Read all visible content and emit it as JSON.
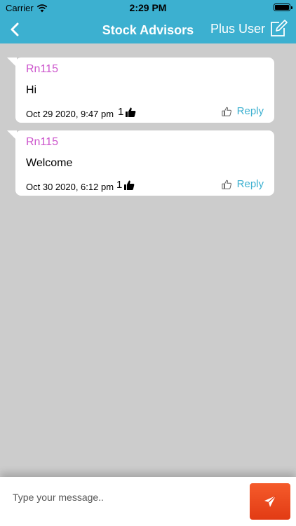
{
  "status_bar": {
    "carrier": "Carrier",
    "time": "2:29 PM"
  },
  "nav": {
    "title": "Stock Advisors",
    "plus_user_label": "Plus User"
  },
  "messages": [
    {
      "author": "Rn115",
      "text": "Hi",
      "date": "Oct 29 2020, 9:47 pm",
      "likes": "1",
      "reply_label": "Reply"
    },
    {
      "author": "Rn115",
      "text": "Welcome",
      "date": "Oct 30 2020, 6:12 pm",
      "likes": "1",
      "reply_label": "Reply"
    }
  ],
  "composer": {
    "placeholder": "Type your message.."
  },
  "colors": {
    "nav_bg": "#3cb0d0",
    "author": "#cc55cc",
    "reply": "#3cb0d0",
    "send": "#e84a1e",
    "background": "#cccccc"
  }
}
